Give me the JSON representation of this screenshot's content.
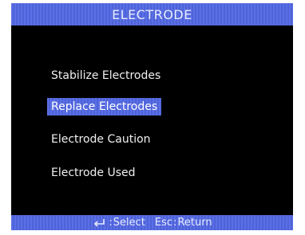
{
  "screen": {
    "title": "ELECTRODE"
  },
  "menu": {
    "items": [
      {
        "label": "Stabilize Electrodes",
        "selected": false
      },
      {
        "label": "Replace Electrodes",
        "selected": true
      },
      {
        "label": "Electrode Caution",
        "selected": false
      },
      {
        "label": "Electrode Used",
        "selected": false
      }
    ]
  },
  "status_bar": {
    "select_key_icon": "enter-key-icon",
    "select_label": "Select",
    "return_key_label": "Esc",
    "return_label": "Return",
    "separator": ":"
  },
  "colors": {
    "bar_blue": "#5b6fe6",
    "screen_bg": "#000000",
    "text": "#f0f0f0"
  }
}
